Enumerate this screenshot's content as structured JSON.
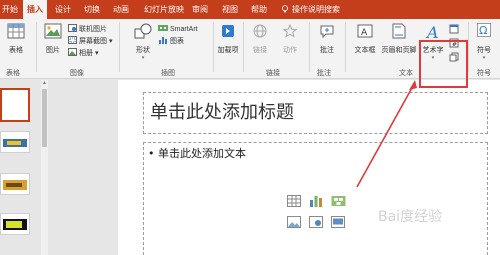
{
  "tabs": [
    "开始",
    "插入",
    "设计",
    "切换",
    "动画",
    "幻灯片放映",
    "审阅",
    "视图",
    "帮助"
  ],
  "tell_me": "操作说明搜索",
  "ribbon": {
    "groups": {
      "tables": "表格",
      "images": "图像",
      "illustrations": "插图",
      "links": "链接",
      "comments": "批注",
      "text": "文本",
      "symbols": "符号"
    },
    "buttons": {
      "table": "表格",
      "picture": "图片",
      "online_pictures": "联机图片",
      "screenshot": "屏幕截图 ▾",
      "album": "相册 ▾",
      "shapes": "形状",
      "smartart": "SmartArt",
      "chart": "图表",
      "addins": "加载项",
      "link": "链接",
      "action": "动作",
      "comment": "批注",
      "textbox": "文本框",
      "header_footer": "页眉和页脚",
      "wordart": "艺术字",
      "symbols": "符号"
    }
  },
  "slide": {
    "title_placeholder": "单击此处添加标题",
    "body_placeholder": "单击此处添加文本"
  },
  "watermark": "Bai度经验",
  "colors": {
    "accent": "#c43e1c",
    "annotation": "#e03a3a"
  }
}
